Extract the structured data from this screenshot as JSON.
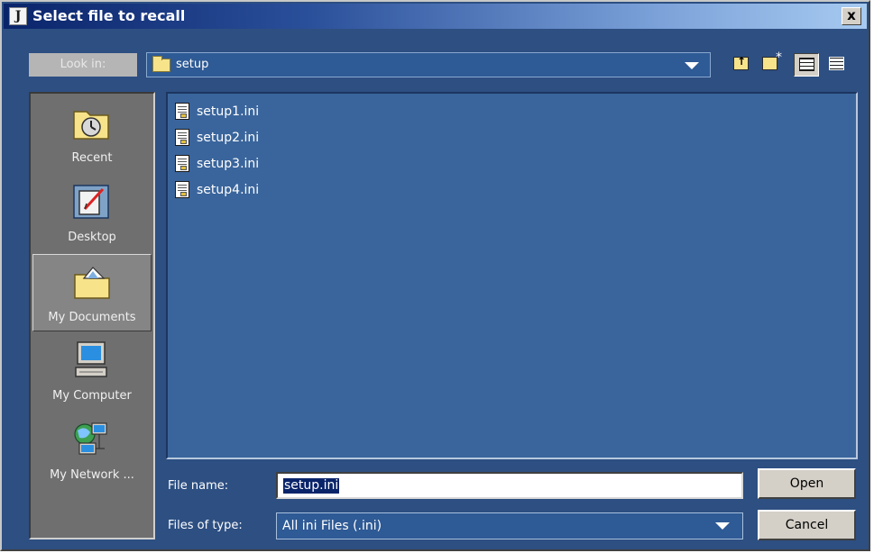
{
  "window": {
    "title": "Select file to recall",
    "close_label": "x"
  },
  "toolbar": {
    "lookin_label": "Look in:",
    "lookin_value": "setup"
  },
  "places": [
    {
      "label": "Recent"
    },
    {
      "label": "Desktop"
    },
    {
      "label": "My Documents",
      "selected": true
    },
    {
      "label": "My Computer"
    },
    {
      "label": "My Network ..."
    }
  ],
  "files": [
    {
      "name": "setup1.ini"
    },
    {
      "name": "setup2.ini"
    },
    {
      "name": "setup3.ini"
    },
    {
      "name": "setup4.ini"
    }
  ],
  "form": {
    "filename_label": "File name:",
    "filename_value": "setup.ini",
    "filetype_label": "Files of type:",
    "filetype_value": "All ini Files (.ini)"
  },
  "buttons": {
    "open": "Open",
    "cancel": "Cancel"
  }
}
